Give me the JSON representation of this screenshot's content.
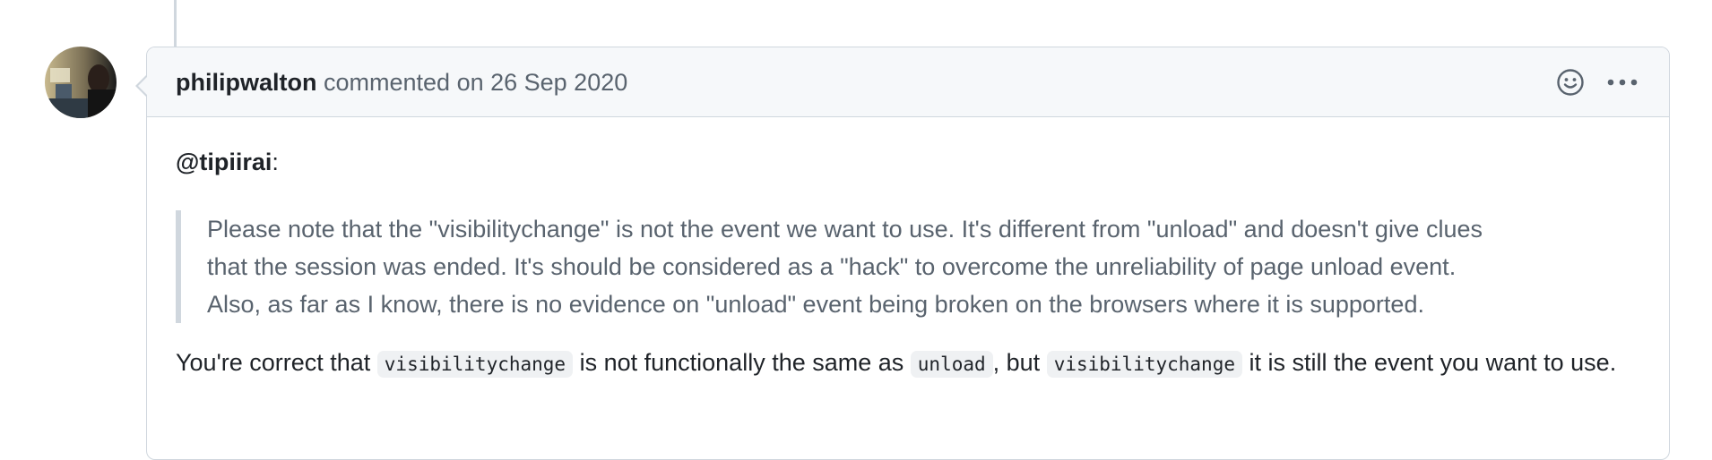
{
  "comment": {
    "author": "philipwalton",
    "action_text": "commented on 26 Sep 2020",
    "mention": "@tipiirai",
    "mention_suffix": ":",
    "quote_lines": [
      "Please note that the \"visibilitychange\" is not the event we want to use. It's different from \"unload\" and doesn't give clues",
      "that the session was ended. It's should be considered as a \"hack\" to overcome the unreliability of page unload event.",
      "Also, as far as I know, there is no evidence on \"unload\" event being broken on the browsers where it is supported."
    ],
    "paragraph": {
      "part1": "You're correct that ",
      "code1": "visibilitychange",
      "part2": " is not functionally the same as ",
      "code2": "unload",
      "part3": ", but ",
      "code3": "visibilitychange",
      "part4": " it is still the event you want to use."
    }
  },
  "icons": {
    "reaction": "smiley-icon",
    "more": "kebab-horizontal-icon"
  },
  "colors": {
    "border": "#d0d7de",
    "header_bg": "#f6f8fa",
    "muted_text": "#59636e",
    "text": "#1f2328"
  }
}
